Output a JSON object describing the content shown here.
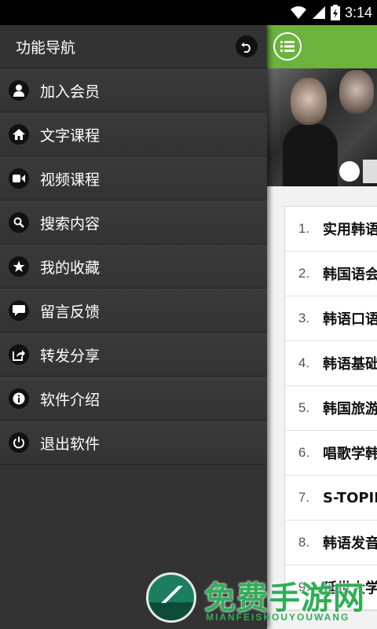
{
  "status": {
    "time": "3:14"
  },
  "drawer": {
    "title": "功能导航",
    "items": [
      {
        "label": "加入会员",
        "icon": "user-icon"
      },
      {
        "label": "文字课程",
        "icon": "home-icon"
      },
      {
        "label": "视频课程",
        "icon": "video-camera-icon"
      },
      {
        "label": "搜索内容",
        "icon": "search-icon"
      },
      {
        "label": "我的收藏",
        "icon": "star-icon"
      },
      {
        "label": "留言反馈",
        "icon": "chat-bubble-icon"
      },
      {
        "label": "转发分享",
        "icon": "share-icon"
      },
      {
        "label": "软件介绍",
        "icon": "info-icon"
      },
      {
        "label": "退出软件",
        "icon": "power-icon"
      }
    ]
  },
  "main": {
    "lessons": [
      {
        "num": "1.",
        "title": "实用韩语"
      },
      {
        "num": "2.",
        "title": "韩国语会"
      },
      {
        "num": "3.",
        "title": "韩语口语"
      },
      {
        "num": "4.",
        "title": "韩语基础"
      },
      {
        "num": "5.",
        "title": "韩国旅游"
      },
      {
        "num": "6.",
        "title": "唱歌学韩"
      },
      {
        "num": "7.",
        "title": "S-TOPIK"
      },
      {
        "num": "8.",
        "title": "韩语发音"
      },
      {
        "num": "9.",
        "title": "延世大学"
      }
    ]
  },
  "watermark": {
    "text": "免费手游网",
    "sub": "MIANFEISHOUYOUWANG"
  },
  "colors": {
    "accent": "#6cb33e",
    "drawer_bg": "#333333",
    "watermark": "#2fae58"
  }
}
